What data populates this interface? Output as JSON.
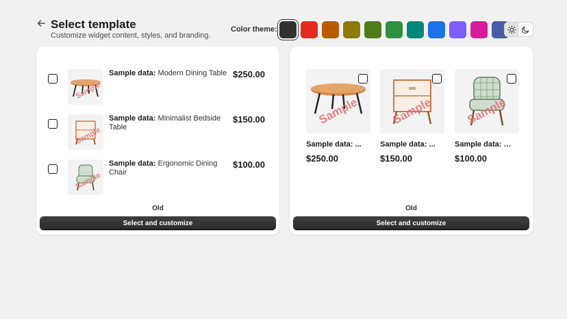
{
  "header": {
    "title": "Select template",
    "subtitle": "Customize widget content, styles, and branding."
  },
  "theme": {
    "label": "Color theme:",
    "swatches": [
      "#303030",
      "#e52b20",
      "#b95b00",
      "#8f7a0c",
      "#4b7d1a",
      "#2e8f3c",
      "#00897b",
      "#1a73e8",
      "#7c5cff",
      "#d81b9b",
      "#4b5ba8"
    ],
    "selected_index": 0,
    "mode_icons": [
      "sun-icon",
      "moon-icon"
    ],
    "active_mode": "light"
  },
  "watermark": "Sample",
  "left_card": {
    "items": [
      {
        "label": "Sample data:",
        "name": "Modern Dining Table",
        "price": "$250.00"
      },
      {
        "label": "Sample data:",
        "name": "Minimalist Bedside Table",
        "price": "$150.00"
      },
      {
        "label": "Sample data:",
        "name": "Ergonomic Dining Chair",
        "price": "$100.00"
      }
    ],
    "caption": "Old",
    "button": "Select and customize"
  },
  "right_card": {
    "items": [
      {
        "title": "Sample data: ...",
        "price": "$250.00"
      },
      {
        "title": "Sample data: ...",
        "price": "$150.00"
      },
      {
        "title": "Sample data: E...",
        "price": "$100.00"
      }
    ],
    "caption": "Old",
    "button": "Select and customize"
  }
}
